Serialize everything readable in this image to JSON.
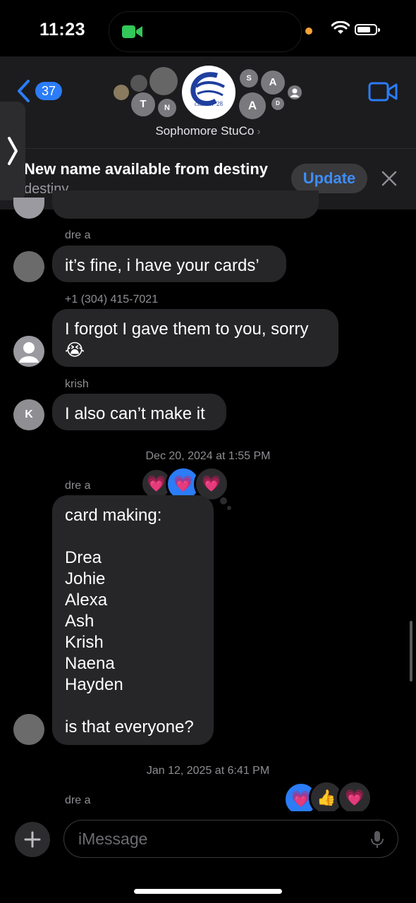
{
  "status": {
    "time": "11:23"
  },
  "header": {
    "back_count": "37",
    "group_name": "Sophomore StuCo",
    "group_photo_text": "class of '28",
    "member_initials": [
      "T",
      "N",
      "S",
      "A",
      "A",
      "D"
    ]
  },
  "banner": {
    "title": "New name available from destiny",
    "subtitle": "destiny",
    "update_label": "Update"
  },
  "messages": [
    {
      "sender": "dre a",
      "text": "it’s fine, i have your cards’"
    },
    {
      "sender": "+1 (304) 415-7021",
      "text": "I forgot I gave them to you, sorry 😭"
    },
    {
      "sender": "krish",
      "text": "I also can’t make it",
      "avatar_initial": "K"
    },
    {
      "timestamp": "Dec 20, 2024 at 1:55 PM"
    },
    {
      "sender": "dre a",
      "lines": [
        "card making:",
        "",
        "Drea",
        "Johie",
        "Alexa",
        "Ash",
        "Krish",
        "Naena",
        "Hayden",
        "",
        "is that everyone?"
      ]
    },
    {
      "timestamp": "Jan 12, 2025 at 6:41 PM"
    },
    {
      "sender": "dre a"
    }
  ],
  "reactions_1": [
    "💗",
    "💗",
    "💗"
  ],
  "reactions_2": [
    "💗",
    "👍",
    "💗"
  ],
  "composer": {
    "placeholder": "iMessage"
  },
  "colors": {
    "accent": "#2b7cf6",
    "bubble": "#262628",
    "background": "#000000"
  }
}
